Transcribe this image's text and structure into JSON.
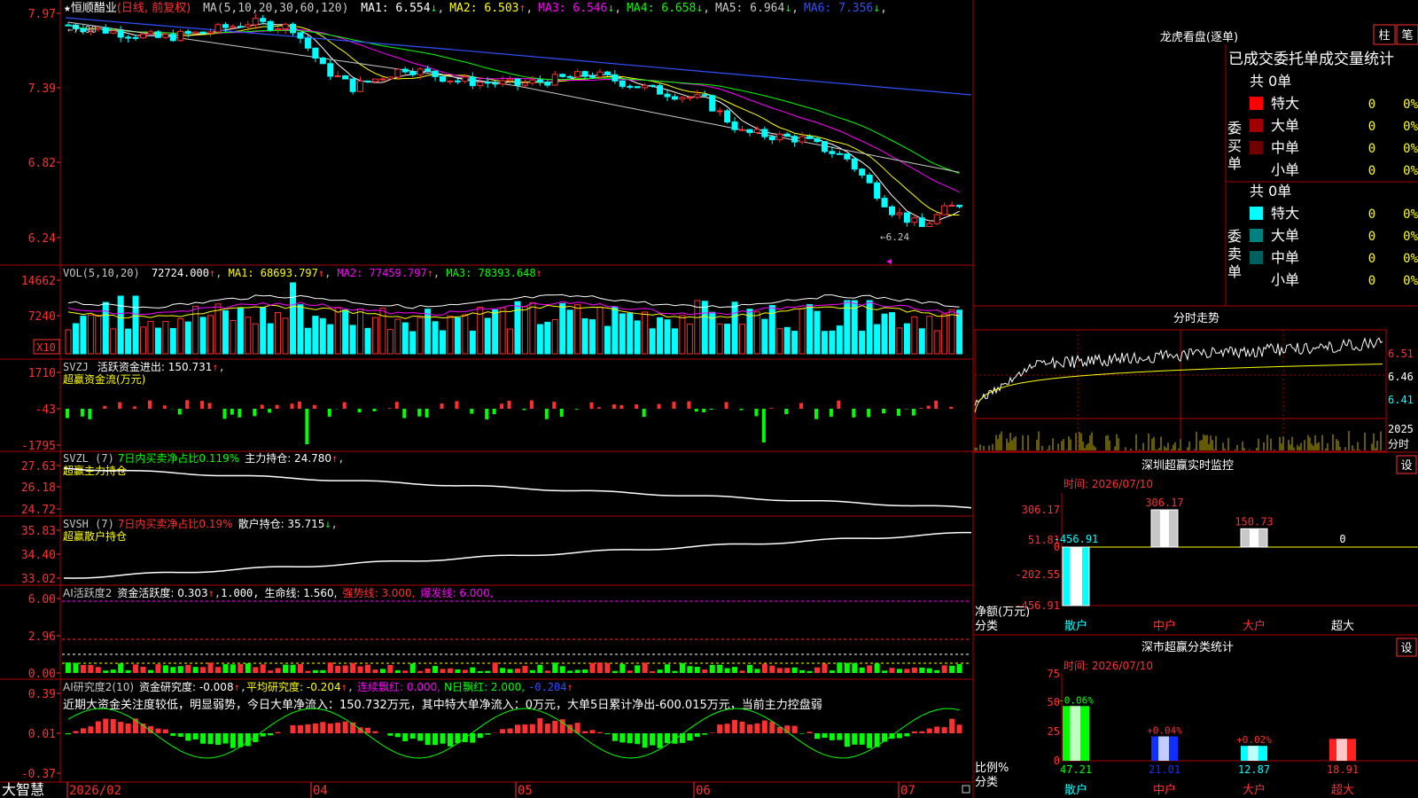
{
  "stock": {
    "star": "★",
    "name": "恒顺醋业",
    "period": "(日线, 前复权)"
  },
  "main": {
    "ma_params": "MA(5,10,20,30,60,120)",
    "ma": [
      {
        "label": "MA1:",
        "value": "6.554",
        "arrow": "↓",
        "color": "#ffffff"
      },
      {
        "label": "MA2:",
        "value": "6.503",
        "arrow": "↑",
        "color": "#ffff00"
      },
      {
        "label": "MA3:",
        "value": "6.546",
        "arrow": "↓",
        "color": "#ff00ff"
      },
      {
        "label": "MA4:",
        "value": "6.658",
        "arrow": "↓",
        "color": "#00ff00"
      },
      {
        "label": "MA5:",
        "value": "6.964",
        "arrow": "↓",
        "color": "#c8c8c8"
      },
      {
        "label": "MA6:",
        "value": "7.356",
        "arrow": "↓",
        "color": "#3050ff"
      }
    ],
    "y_ticks": [
      "7.97",
      "7.39",
      "6.82",
      "6.24"
    ],
    "high_label": "7.90",
    "low_label": "6.24"
  },
  "vol": {
    "params": "VOL(5,10,20)",
    "value": "72724.000",
    "ma1": "68693.797",
    "ma2": "77459.797",
    "ma3": "78393.648",
    "y_ticks": [
      "14662",
      "7240"
    ],
    "unit": "X10"
  },
  "svzj": {
    "title": "SVZJ",
    "label": "活跃资金进出: 150.731",
    "sub": "超赢资金流(万元)",
    "y_ticks": [
      "1710",
      "-43",
      "-1795"
    ]
  },
  "svzl": {
    "title": "SVZL (7)",
    "ratio": "7日内买卖净占比0.119%",
    "hold": "主力持仓: 24.780",
    "sub": "超赢主力持仓",
    "y_ticks": [
      "27.63",
      "26.18",
      "24.72"
    ]
  },
  "svsh": {
    "title": "SVSH (7)",
    "ratio": "7日内买卖净占比0.19%",
    "hold": "散户持仓: 35.715",
    "sub": "超赢散户持仓",
    "y_ticks": [
      "35.83",
      "34.40",
      "33.02"
    ]
  },
  "ai1": {
    "title": "AI活跃度2",
    "act": "资金活跃度: 0.303",
    "v1": "1.000,",
    "life": "生命线: 1.560,",
    "strong": "强势线: 3.000,",
    "burst": "爆发线: 6.000,",
    "y_ticks": [
      "6.00",
      "2.96",
      "0.00"
    ]
  },
  "ai2": {
    "title": "AI研究度2(10)",
    "res": "资金研究度: -0.008",
    "avg": "平均研究度: -0.204",
    "cont": "连续飘红: 0.000,",
    "nday": "N日飘红: 2.000,",
    "last": "-0.204",
    "comment": "近期大资金关注度较低，明显弱势，今日大单净流入：150.732万元，其中特大单净流入：0万元，大单5日累计净出-600.015万元，当前主力控盘弱",
    "y_ticks": [
      "0.39",
      "0.01",
      "-0.37"
    ]
  },
  "xaxis": {
    "brand": "大智慧",
    "labels": [
      "2026/02",
      "04",
      "05",
      "06",
      "07"
    ]
  },
  "lhb": {
    "title": "龙虎看盘(逐单)",
    "btn_col": "柱",
    "btn_pen": "笔",
    "header": "已成交委托单成交量统计",
    "buy": {
      "side": "委买单",
      "total": "共 0单",
      "rows": [
        {
          "name": "特大",
          "count": "0",
          "pct": "0%"
        },
        {
          "name": "大单",
          "count": "0",
          "pct": "0%"
        },
        {
          "name": "中单",
          "count": "0",
          "pct": "0%"
        },
        {
          "name": "小单",
          "count": "0",
          "pct": "0%"
        }
      ]
    },
    "sell": {
      "side": "委卖单",
      "total": "共 0单",
      "rows": [
        {
          "name": "特大",
          "count": "0",
          "pct": "0%"
        },
        {
          "name": "大单",
          "count": "0",
          "pct": "0%"
        },
        {
          "name": "中单",
          "count": "0",
          "pct": "0%"
        },
        {
          "name": "小单",
          "count": "0",
          "pct": "0%"
        }
      ]
    }
  },
  "intraday": {
    "title": "分时走势",
    "y_ticks": [
      "6.51",
      "6.46",
      "6.41"
    ],
    "vol_tick": "2025",
    "label": "分时"
  },
  "monitor": {
    "title": "深圳超赢实时监控",
    "btn": "设",
    "time": "时间: 2026/07/10",
    "y_ticks": [
      "306.17",
      "51.81",
      "0",
      "-202.55",
      "-456.91"
    ],
    "bars": [
      {
        "name": "散户",
        "value": -456.91,
        "label": "-456.91",
        "color": "#00ffff"
      },
      {
        "name": "中户",
        "value": 306.17,
        "label": "306.17",
        "color": "#c8c8c8"
      },
      {
        "name": "大户",
        "value": 150.73,
        "label": "150.73",
        "color": "#c8c8c8"
      },
      {
        "name": "超大",
        "value": 0,
        "label": "0",
        "color": "#c8c8c8"
      }
    ],
    "axis_label_1": "净额(万元)",
    "axis_label_2": "分类"
  },
  "classify": {
    "title": "深市超赢分类统计",
    "btn": "设",
    "time": "时间: 2026/07/10",
    "y_ticks": [
      "75",
      "50",
      "25",
      "0"
    ],
    "bars": [
      {
        "name": "散户",
        "value": 47.21,
        "label": "47.21",
        "delta": "-0.06%",
        "color": "#00ff00"
      },
      {
        "name": "中户",
        "value": 21.01,
        "label": "21.01",
        "delta": "+0.04%",
        "color": "#1030ff"
      },
      {
        "name": "大户",
        "value": 12.87,
        "label": "12.87",
        "delta": "+0.02%",
        "color": "#00ffff"
      },
      {
        "name": "超大",
        "value": 18.91,
        "label": "18.91",
        "delta": "",
        "color": "#ff2020"
      }
    ],
    "axis_label_1": "比例%",
    "axis_label_2": "分类"
  }
}
